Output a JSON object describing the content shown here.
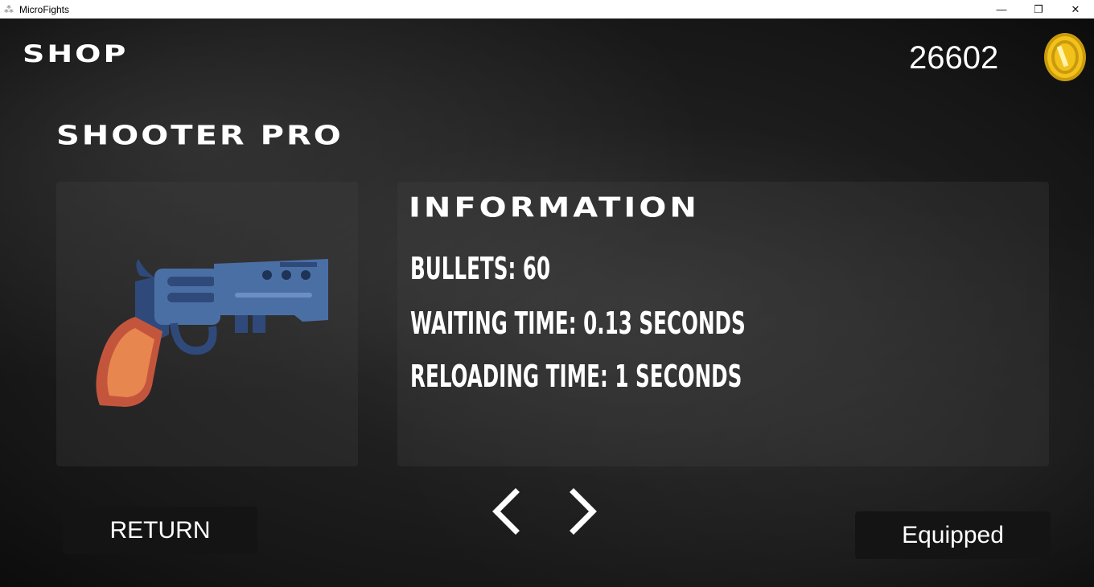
{
  "window": {
    "title": "MicroFights",
    "controls": {
      "minimize": "—",
      "restore": "❐",
      "close": "✕"
    }
  },
  "header": {
    "title": "SHOP",
    "coins": "26602",
    "coin_icon": "coin-icon"
  },
  "weapon": {
    "name": "SHOOTER PRO",
    "image_icon": "revolver-icon"
  },
  "info": {
    "title": "INFORMATION",
    "bullets": "BULLETS: 60",
    "waiting_time": "WAITING TIME: 0.13 SECONDS",
    "reloading_time": "RELOADING TIME: 1 SECONDS"
  },
  "nav": {
    "prev_icon": "chevron-left-icon",
    "next_icon": "chevron-right-icon"
  },
  "buttons": {
    "return_label": "RETURN",
    "equipped_label": "Equipped"
  },
  "colors": {
    "gun_body": "#4a6fa5",
    "gun_dark": "#2f4a7a",
    "grip": "#e8864f",
    "grip_outline": "#c4553d",
    "coin": "#f2c21b",
    "button_bg": "#141414"
  }
}
